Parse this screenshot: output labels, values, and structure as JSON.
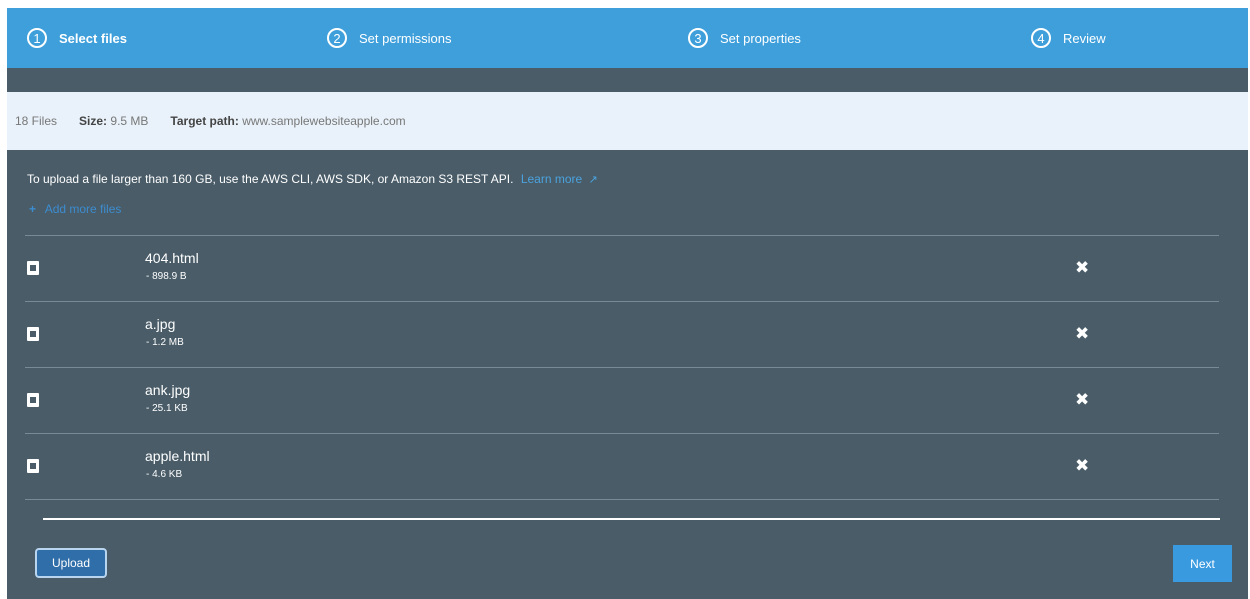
{
  "steps": [
    {
      "number": "1",
      "label": "Select files"
    },
    {
      "number": "2",
      "label": "Set permissions"
    },
    {
      "number": "3",
      "label": "Set properties"
    },
    {
      "number": "4",
      "label": "Review"
    }
  ],
  "info": {
    "count": "18 Files",
    "size_label": "Size:",
    "size_value": "9.5 MB",
    "target_label": "Target path:",
    "target_value": "www.samplewebsiteapple.com"
  },
  "notice": {
    "text": "To upload a file larger than 160 GB, use the AWS CLI, AWS SDK, or Amazon S3 REST API.",
    "link": "Learn more",
    "link_icon": "external-link-icon"
  },
  "add_more": "Add more files",
  "files": [
    {
      "name": "404.html",
      "size": "- 898.9 B",
      "icon": "document-icon"
    },
    {
      "name": "a.jpg",
      "size": "- 1.2 MB",
      "icon": "image-file-icon"
    },
    {
      "name": "ank.jpg",
      "size": "- 25.1 KB",
      "icon": "image-file-icon"
    },
    {
      "name": "apple.html",
      "size": "- 4.6 KB",
      "icon": "document-icon"
    }
  ],
  "buttons": {
    "upload": "Upload",
    "next": "Next"
  },
  "colors": {
    "header": "#3e9fdb",
    "panel": "#495c68",
    "info_bar": "#e9f2fa",
    "link": "#4aa3df"
  }
}
